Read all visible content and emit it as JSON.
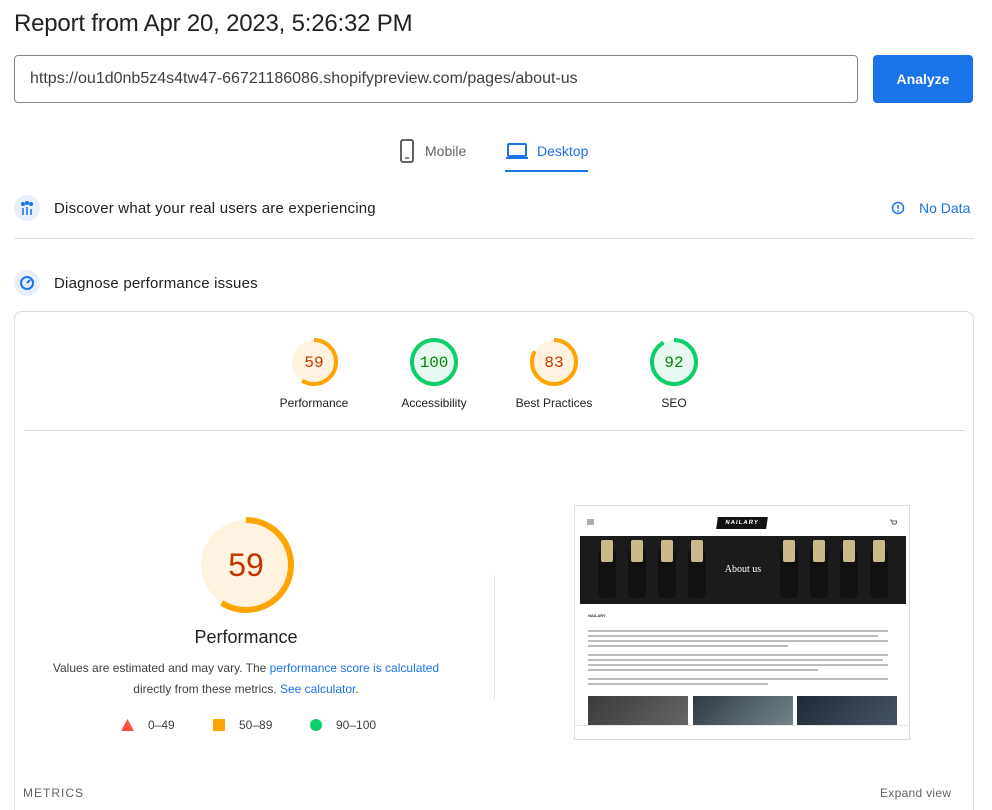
{
  "header": {
    "title": "Report from Apr 20, 2023, 5:26:32 PM"
  },
  "url_bar": {
    "value": "https://ou1d0nb5z4s4tw47-66721186086.shopifypreview.com/pages/about-us",
    "analyze_label": "Analyze"
  },
  "tabs": [
    {
      "label": "Mobile",
      "icon": "phone-icon",
      "selected": false
    },
    {
      "label": "Desktop",
      "icon": "laptop-icon",
      "selected": true
    }
  ],
  "crux": {
    "title": "Discover what your real users are experiencing",
    "status": "No Data"
  },
  "diagnose": {
    "title": "Diagnose performance issues"
  },
  "categories": [
    {
      "label": "Performance",
      "score": "59",
      "color": "#ffa400",
      "fill": "#fff3e0",
      "text_color": "#c33300"
    },
    {
      "label": "Accessibility",
      "score": "100",
      "color": "#0cce6b",
      "fill": "#e6f8ef",
      "text_color": "#008800"
    },
    {
      "label": "Best Practices",
      "score": "83",
      "color": "#ffa400",
      "fill": "#fff3e0",
      "text_color": "#c33300"
    },
    {
      "label": "SEO",
      "score": "92",
      "color": "#0cce6b",
      "fill": "#e6f8ef",
      "text_color": "#008800"
    }
  ],
  "performance": {
    "score": "59",
    "title": "Performance",
    "desc_1": "Values are estimated and may vary. The ",
    "desc_link_1": "performance score is calculated",
    "desc_2": "directly from these metrics. ",
    "desc_link_2": "See calculator",
    "desc_3": "."
  },
  "legend": [
    {
      "shape": "triangle",
      "range": "0–49",
      "color": "#ff4e42"
    },
    {
      "shape": "square",
      "range": "50–89",
      "color": "#ffa400"
    },
    {
      "shape": "circle",
      "range": "90–100",
      "color": "#0cce6b"
    }
  ],
  "screenshot": {
    "logo": "NAILARY",
    "hero_text": "About us",
    "heading": "NAILARY"
  },
  "metrics": {
    "label": "METRICS",
    "expand": "Expand view"
  },
  "colors": {
    "accent": "#1a73e8"
  }
}
